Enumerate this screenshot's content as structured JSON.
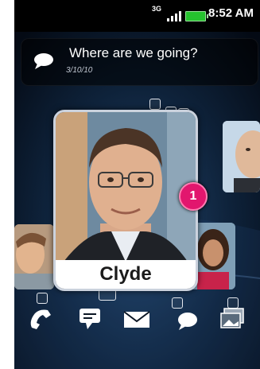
{
  "status_bar": {
    "network": "3G",
    "time": "8:52 AM"
  },
  "message": {
    "text": "Where are we going?",
    "date": "3/10/10",
    "icon": "speech-bubble-icon"
  },
  "contact": {
    "name": "Clyde",
    "unread_count": "1"
  },
  "dock": {
    "items": [
      {
        "icon": "phone-icon"
      },
      {
        "icon": "sms-icon"
      },
      {
        "icon": "mail-icon"
      },
      {
        "icon": "chat-icon"
      },
      {
        "icon": "gallery-icon"
      }
    ]
  },
  "colors": {
    "badge": "#e2166e",
    "battery": "#25c22e",
    "background": "#071220"
  }
}
